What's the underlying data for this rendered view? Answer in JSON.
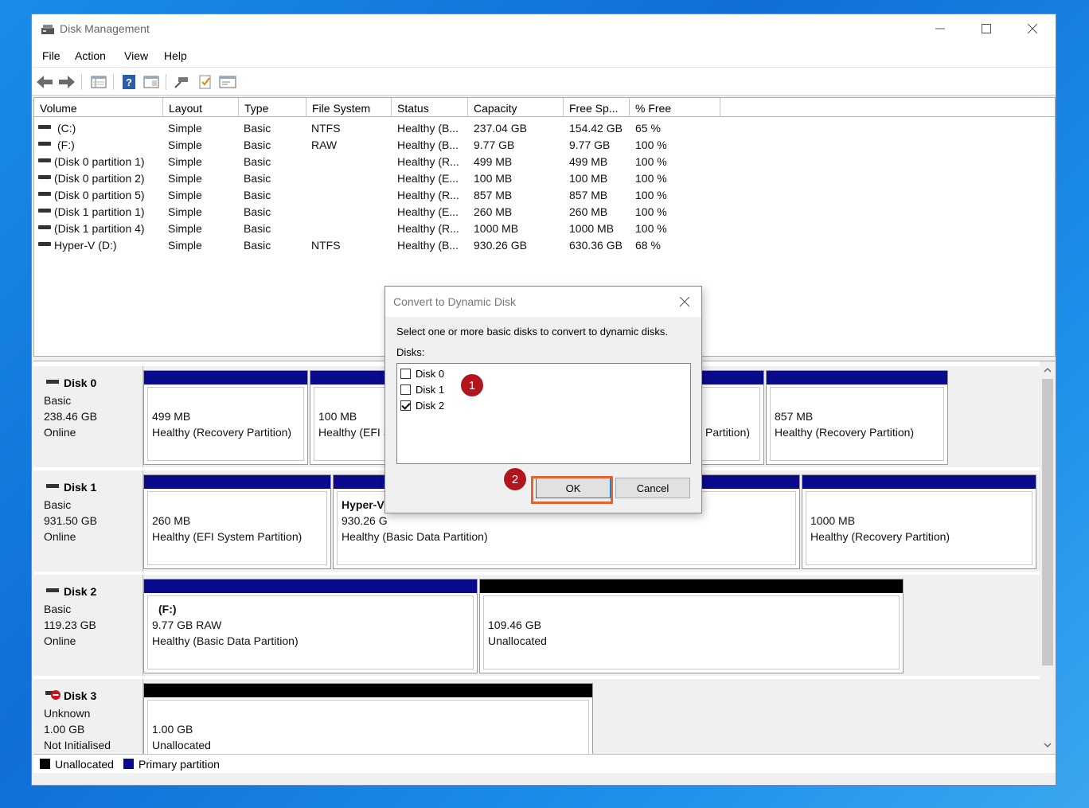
{
  "window": {
    "title": "Disk Management"
  },
  "menu": [
    "File",
    "Action",
    "View",
    "Help"
  ],
  "toolbar_icons": [
    "back-arrow-icon",
    "forward-arrow-icon",
    "disk-list-icon",
    "help-icon",
    "properties-icon",
    "connect-icon",
    "check-icon",
    "console-icon"
  ],
  "columns": [
    "Volume",
    "Layout",
    "Type",
    "File System",
    "Status",
    "Capacity",
    "Free Sp...",
    "% Free"
  ],
  "volumes": [
    {
      "volume": "(C:)",
      "layout": "Simple",
      "type": "Basic",
      "fs": "NTFS",
      "status": "Healthy (B...",
      "capacity": "237.04 GB",
      "free": "154.42 GB",
      "pct": "65 %"
    },
    {
      "volume": "(F:)",
      "layout": "Simple",
      "type": "Basic",
      "fs": "RAW",
      "status": "Healthy (B...",
      "capacity": "9.77 GB",
      "free": "9.77 GB",
      "pct": "100 %"
    },
    {
      "volume": "(Disk 0 partition 1)",
      "layout": "Simple",
      "type": "Basic",
      "fs": "",
      "status": "Healthy (R...",
      "capacity": "499 MB",
      "free": "499 MB",
      "pct": "100 %"
    },
    {
      "volume": "(Disk 0 partition 2)",
      "layout": "Simple",
      "type": "Basic",
      "fs": "",
      "status": "Healthy (E...",
      "capacity": "100 MB",
      "free": "100 MB",
      "pct": "100 %"
    },
    {
      "volume": "(Disk 0 partition 5)",
      "layout": "Simple",
      "type": "Basic",
      "fs": "",
      "status": "Healthy (R...",
      "capacity": "857 MB",
      "free": "857 MB",
      "pct": "100 %"
    },
    {
      "volume": "(Disk 1 partition 1)",
      "layout": "Simple",
      "type": "Basic",
      "fs": "",
      "status": "Healthy (E...",
      "capacity": "260 MB",
      "free": "260 MB",
      "pct": "100 %"
    },
    {
      "volume": "(Disk 1 partition 4)",
      "layout": "Simple",
      "type": "Basic",
      "fs": "",
      "status": "Healthy (R...",
      "capacity": "1000 MB",
      "free": "1000 MB",
      "pct": "100 %"
    },
    {
      "volume": "Hyper-V (D:)",
      "layout": "Simple",
      "type": "Basic",
      "fs": "NTFS",
      "status": "Healthy (B...",
      "capacity": "930.26 GB",
      "free": "630.36 GB",
      "pct": "68 %"
    }
  ],
  "disks": [
    {
      "name": "Disk 0",
      "kind": "Basic",
      "size": "238.46 GB",
      "state": "Online",
      "partitions": [
        {
          "l1": "499 MB",
          "l2": "Healthy (Recovery Partition)"
        },
        {
          "l1": "100 MB",
          "l2": "Healthy (EFI S"
        },
        {
          "l1": "",
          "l2": "Partition)"
        },
        {
          "l1": "857 MB",
          "l2": "Healthy (Recovery Partition)"
        }
      ]
    },
    {
      "name": "Disk 1",
      "kind": "Basic",
      "size": "931.50 GB",
      "state": "Online",
      "partitions": [
        {
          "l1": "260 MB",
          "l2": "Healthy (EFI System Partition)"
        },
        {
          "l0": "Hyper-V",
          "l1": "930.26 G",
          "l2": "Healthy (Basic Data Partition)"
        },
        {
          "l1": "1000 MB",
          "l2": "Healthy (Recovery Partition)"
        }
      ]
    },
    {
      "name": "Disk 2",
      "kind": "Basic",
      "size": "119.23 GB",
      "state": "Online",
      "partitions": [
        {
          "l0": "(F:)",
          "l1": "9.77 GB RAW",
          "l2": "Healthy (Basic Data Partition)"
        },
        {
          "l1": "109.46 GB",
          "l2": "Unallocated"
        }
      ]
    },
    {
      "name": "Disk 3",
      "kind": "Unknown",
      "size": "1.00 GB",
      "state": "Not Initialised",
      "partitions": [
        {
          "l1": "1.00 GB",
          "l2": "Unallocated"
        }
      ]
    }
  ],
  "legend": [
    {
      "label": "Unallocated",
      "color": "#000000"
    },
    {
      "label": "Primary partition",
      "color": "#0a0a8c"
    }
  ],
  "dialog": {
    "title": "Convert to Dynamic Disk",
    "instruction": "Select one or more basic disks to convert to dynamic disks.",
    "list_label": "Disks:",
    "disks": [
      {
        "label": "Disk 0",
        "checked": false
      },
      {
        "label": "Disk 1",
        "checked": false
      },
      {
        "label": "Disk 2",
        "checked": true
      }
    ],
    "ok_label": "OK",
    "cancel_label": "Cancel"
  },
  "callouts": [
    "1",
    "2"
  ],
  "colors": {
    "primary_partition": "#0a0a8c",
    "unallocated": "#000000",
    "highlight": "#e8632b",
    "callout": "#b0161c"
  }
}
